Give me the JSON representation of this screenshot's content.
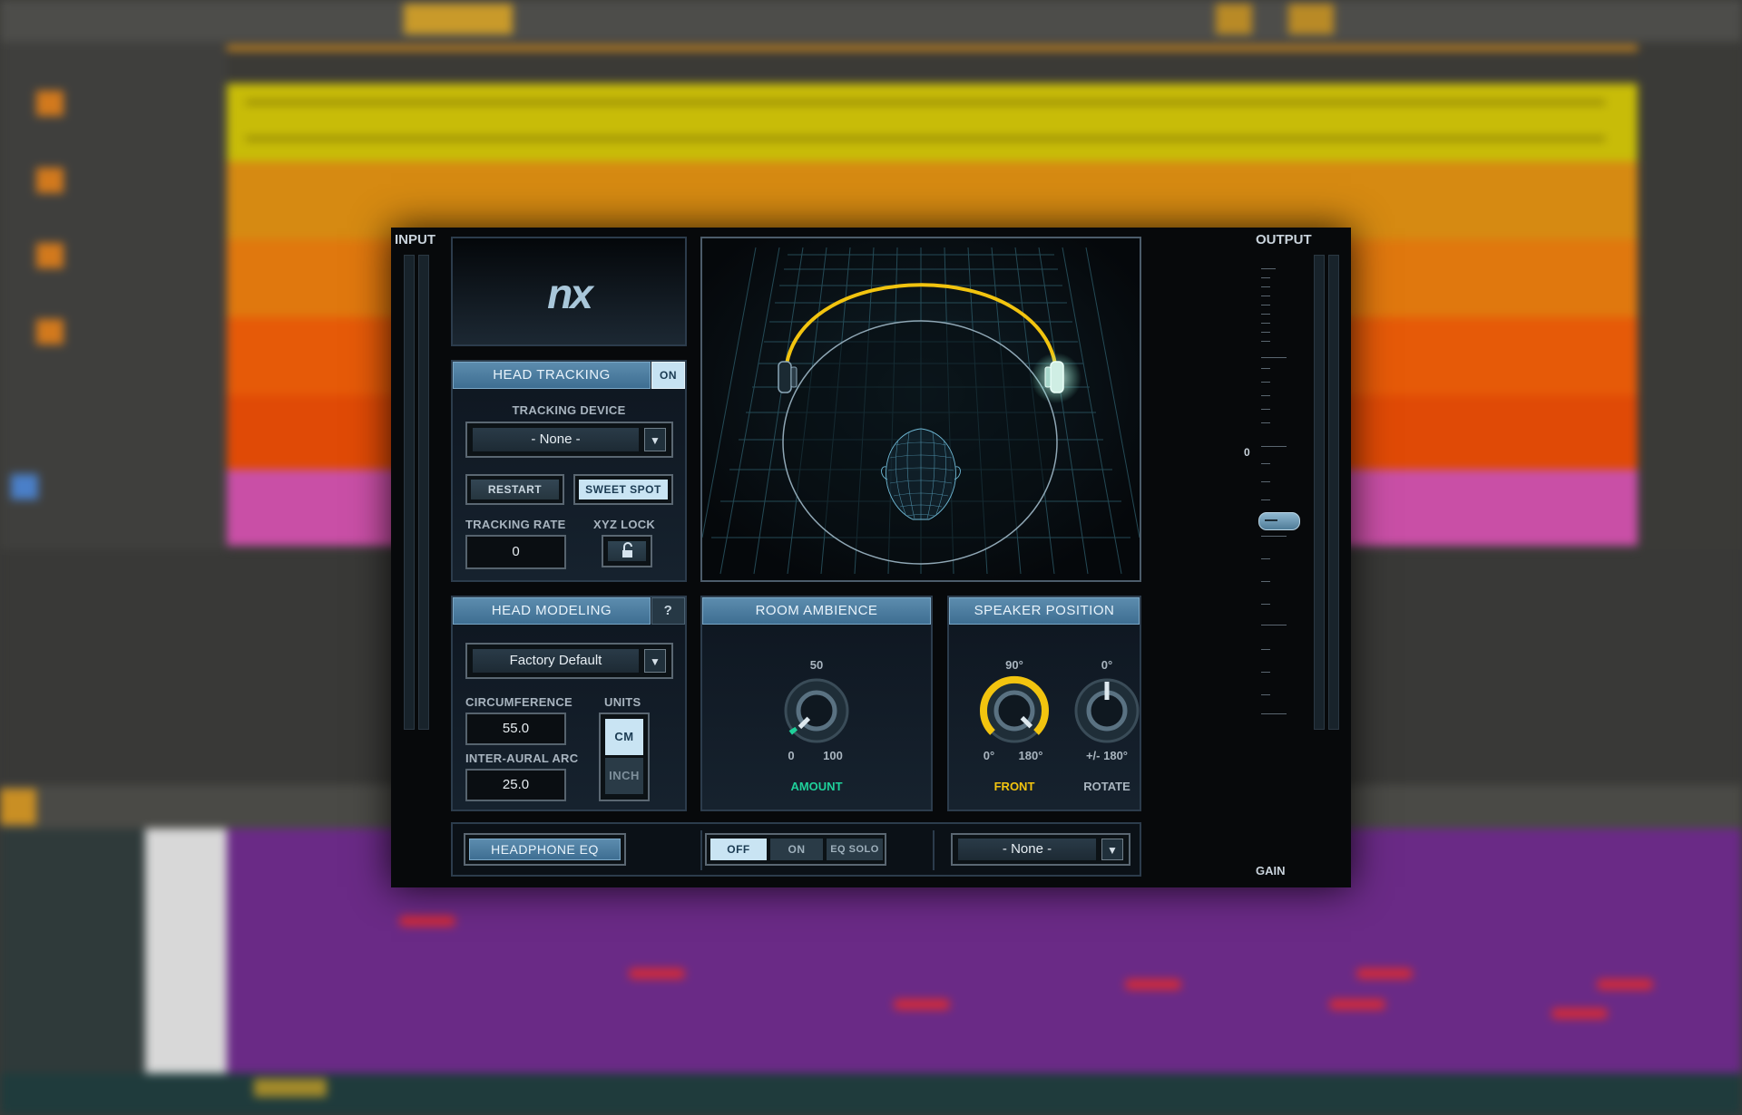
{
  "plugin": {
    "logo_text": "nx",
    "input_label": "INPUT",
    "output_label": "OUTPUT",
    "gain_label": "GAIN",
    "gain_scale_zero": "0",
    "head_tracking": {
      "title": "HEAD TRACKING",
      "toggle": "ON",
      "device_label": "TRACKING DEVICE",
      "device_value": "- None -",
      "restart_label": "RESTART",
      "sweet_spot_label": "SWEET SPOT",
      "rate_label": "TRACKING RATE",
      "rate_value": "0",
      "xyz_lock_label": "XYZ LOCK"
    },
    "head_modeling": {
      "title": "HEAD MODELING",
      "help": "?",
      "preset_value": "Factory Default",
      "circumference_label": "CIRCUMFERENCE",
      "circumference_value": "55.0",
      "interaural_label": "INTER-AURAL ARC",
      "interaural_value": "25.0",
      "units_label": "UNITS",
      "unit_cm": "CM",
      "unit_inch": "INCH",
      "selected_unit": "CM"
    },
    "room_ambience": {
      "title": "ROOM AMBIENCE",
      "knob_top": "50",
      "knob_min": "0",
      "knob_max": "100",
      "knob_label": "AMOUNT",
      "amount_value": 0.02,
      "label_color": "#1fd09a"
    },
    "speaker_position": {
      "title": "SPEAKER POSITION",
      "front_top": "90°",
      "front_min": "0°",
      "front_max": "180°",
      "front_label": "FRONT",
      "front_color": "#f2c40f",
      "rotate_top": "0°",
      "rotate_range": "+/- 180°",
      "rotate_label": "ROTATE"
    },
    "headphone_eq": {
      "title": "HEADPHONE EQ",
      "options": [
        "OFF",
        "ON",
        "EQ SOLO"
      ],
      "selected": "OFF",
      "model_value": "- None -"
    },
    "colors": {
      "accent_blue": "#4a7fa5",
      "headband_yellow": "#f2c40f",
      "grid_cyan": "#3f7f8f"
    }
  }
}
